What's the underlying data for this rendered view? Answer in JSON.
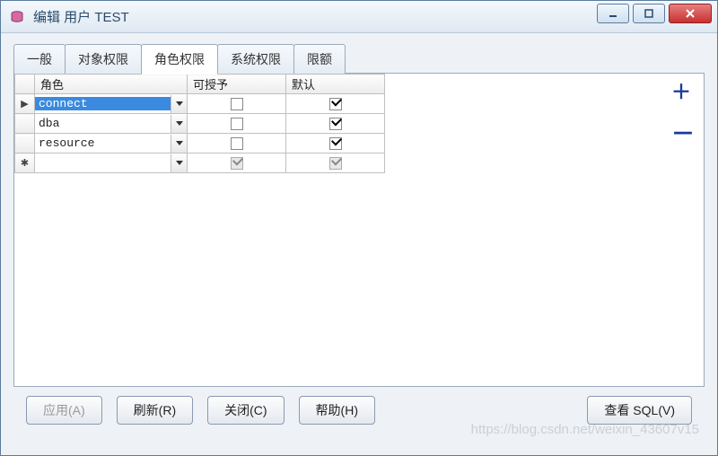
{
  "window": {
    "title": "编辑 用户 TEST"
  },
  "tabs": {
    "items": [
      {
        "label": "一般"
      },
      {
        "label": "对象权限"
      },
      {
        "label": "角色权限"
      },
      {
        "label": "系统权限"
      },
      {
        "label": "限额"
      }
    ],
    "active_index": 2
  },
  "grid": {
    "columns": {
      "role": "角色",
      "grantable": "可授予",
      "default": "默认"
    },
    "rows": [
      {
        "handle": "▶",
        "role": "connect",
        "selected": true,
        "grantable": false,
        "default": true,
        "new": false
      },
      {
        "handle": "",
        "role": "dba",
        "selected": false,
        "grantable": false,
        "default": true,
        "new": false
      },
      {
        "handle": "",
        "role": "resource",
        "selected": false,
        "grantable": false,
        "default": true,
        "new": false
      },
      {
        "handle": "✱",
        "role": "",
        "selected": false,
        "grantable": true,
        "default": true,
        "new": true
      }
    ]
  },
  "side": {
    "add": "＋",
    "remove": "－"
  },
  "buttons": {
    "apply": "应用(A)",
    "refresh": "刷新(R)",
    "close": "关闭(C)",
    "help": "帮助(H)",
    "viewsql": "查看 SQL(V)"
  },
  "watermark": "https://blog.csdn.net/weixin_43607v15"
}
